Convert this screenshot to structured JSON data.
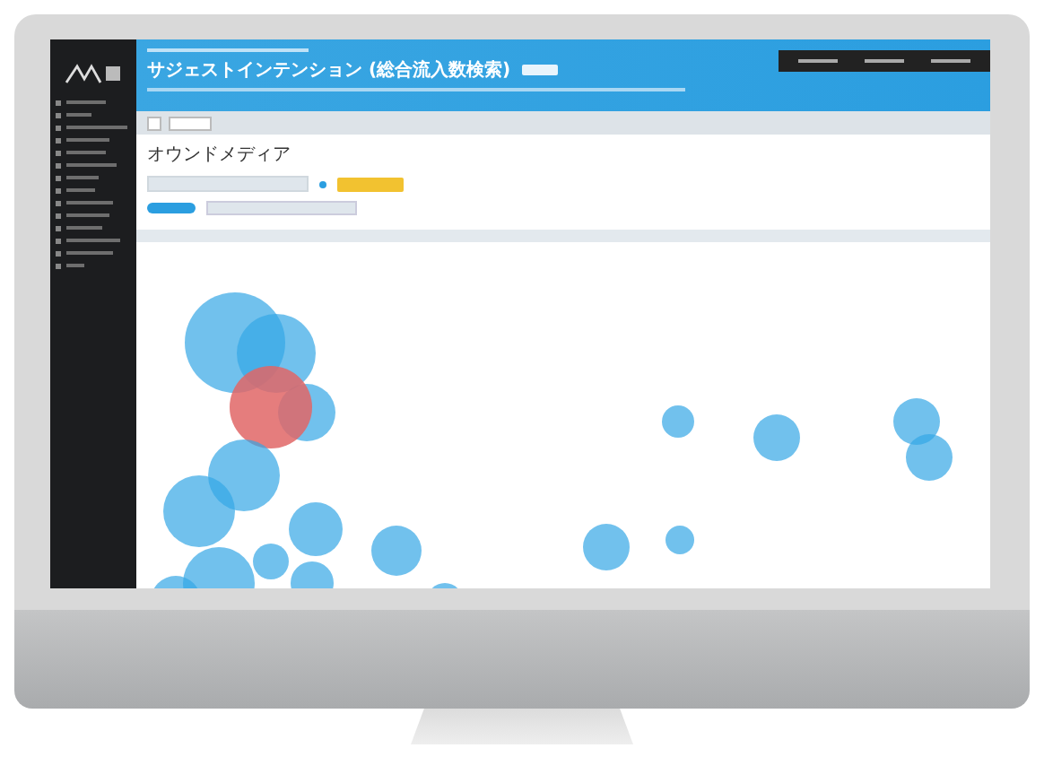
{
  "header": {
    "title": "サジェストインテンション (総合流入数検索)"
  },
  "page": {
    "heading": "オウンドメディア"
  },
  "radio": {
    "selected": true
  }
}
